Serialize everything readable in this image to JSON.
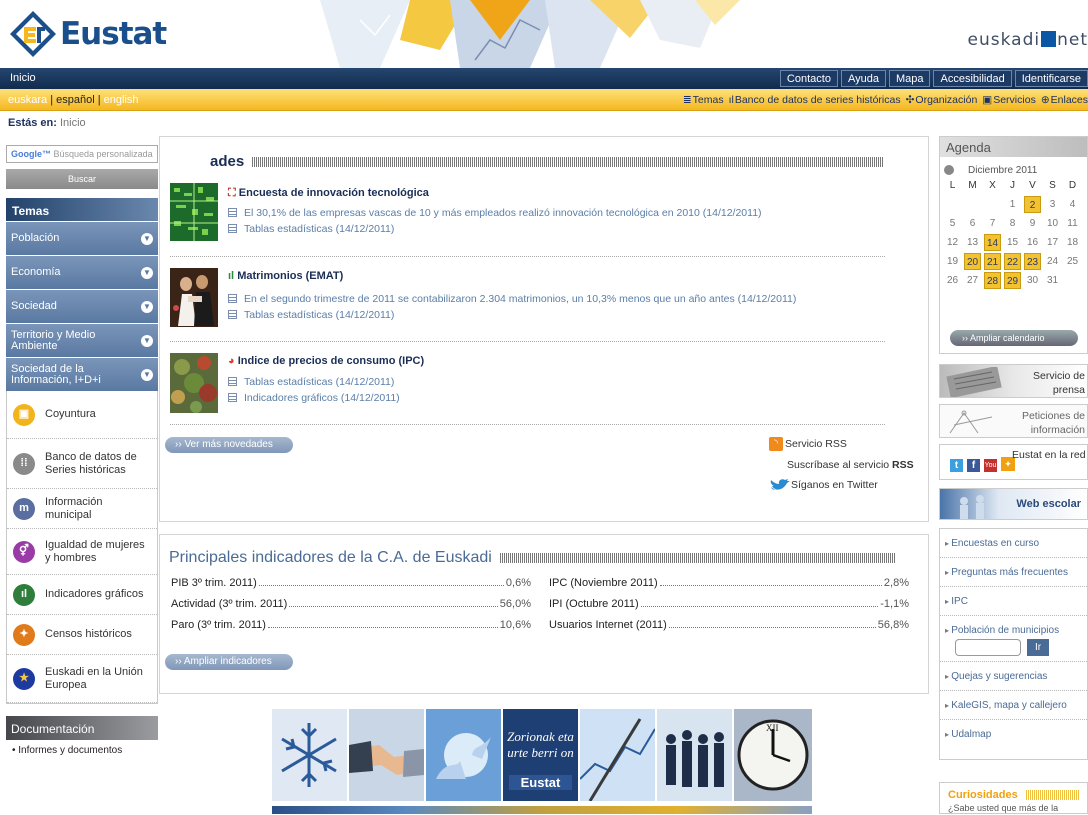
{
  "header": {
    "logo_text": "Eustat",
    "euskadinet": {
      "pre": "euskadi",
      "post": "net"
    }
  },
  "navbar": {
    "home": "Inicio",
    "links": [
      "Contacto",
      "Ayuda",
      "Mapa",
      "Accesibilidad",
      "Identificarse"
    ]
  },
  "langbar": {
    "lang_euskara": "euskara",
    "lang_sep1": " | ",
    "lang_espanol": "español",
    "lang_sep2": " | ",
    "lang_english": "english",
    "sections": [
      "Temas",
      "Banco de datos de series históricas",
      "Organización",
      "Servicios",
      "Enlaces"
    ]
  },
  "breadcrumb": {
    "label": "Estás en:",
    "current": "Inicio"
  },
  "left": {
    "search_placeholder": "Búsqueda personalizada",
    "google": "Google™",
    "search_button": "Buscar",
    "temas_title": "Temas",
    "temas": [
      "Población",
      "Economía",
      "Sociedad",
      "Territorio y Medio Ambiente",
      "Sociedad de la Información, I+D+i"
    ],
    "tools": [
      "Coyuntura",
      "Banco de datos de Series históricas",
      "Información municipal",
      "Igualdad de mujeres y hombres",
      "Indicadores gráficos",
      "Censos históricos",
      "Euskadi en la Unión Europea"
    ],
    "docs_title": "Documentación",
    "docs_items": [
      "Informes y documentos"
    ]
  },
  "novedades": {
    "title": "ades",
    "items": [
      {
        "title": "Encuesta de innovación tecnológica",
        "links": [
          "El 30,1% de las empresas vascas de 10 y más empleados realizó innovación tecnológica en 2010 (14/12/2011)",
          "Tablas estadísticas (14/12/2011)"
        ]
      },
      {
        "title": "Matrimonios (EMAT)",
        "links": [
          "En el segundo trimestre de 2011 se contabilizaron 2.304 matrimonios, un 10,3% menos que un año antes (14/12/2011)",
          "Tablas estadísticas (14/12/2011)"
        ]
      },
      {
        "title": "Indice de precios de consumo (IPC)",
        "links": [
          "Tablas estadísticas (14/12/2011)",
          "Indicadores gráficos (14/12/2011)"
        ]
      }
    ],
    "more_button": "›› Ver más novedades",
    "rss": "Servicio RSS",
    "rss_sub": "Suscríbase al servicio",
    "rss_bold": "RSS",
    "twitter": "Síganos en Twitter"
  },
  "indicators": {
    "title": "Principales indicadores de la C.A. de Euskadi",
    "left": [
      {
        "k": "PIB 3º trim. 2011)",
        "v": "0,6%"
      },
      {
        "k": "Actividad (3º trim. 2011)",
        "v": "56,0%"
      },
      {
        "k": "Paro (3º trim. 2011)",
        "v": "10,6%"
      }
    ],
    "right": [
      {
        "k": "IPC (Noviembre 2011)",
        "v": "2,8%"
      },
      {
        "k": "IPI (Octubre 2011)",
        "v": "-1,1%"
      },
      {
        "k": "Usuarios Internet (2011)",
        "v": "56,8%"
      }
    ],
    "more_button": "›› Ampliar indicadores"
  },
  "greeting": {
    "line1": "Zorionak eta",
    "line2": "urte berri on",
    "brand": "Eustat"
  },
  "agenda": {
    "title": "Agenda",
    "month": "Diciembre 2011",
    "weekdays": [
      "L",
      "M",
      "X",
      "J",
      "V",
      "S",
      "D"
    ],
    "days": [
      "",
      "",
      "",
      "1",
      "2",
      "3",
      "4",
      "5",
      "6",
      "7",
      "8",
      "9",
      "10",
      "11",
      "12",
      "13",
      "14",
      "15",
      "16",
      "17",
      "18",
      "19",
      "20",
      "21",
      "22",
      "23",
      "24",
      "25",
      "26",
      "27",
      "28",
      "29",
      "30",
      "31"
    ],
    "event_days": [
      "2",
      "14",
      "20",
      "21",
      "22",
      "23",
      "28",
      "29"
    ],
    "more_button": "›› Ampliar calendario"
  },
  "right": {
    "prensa": [
      "Servicio de",
      "prensa"
    ],
    "peticiones": [
      "Peticiones de",
      "información"
    ],
    "social": "Eustat en la red",
    "escolar": "Web escolar",
    "links": [
      "Encuestas en curso",
      "Preguntas más frecuentes",
      "IPC",
      "Población de municipios",
      "Quejas y sugerencias",
      "KaleGIS, mapa y callejero",
      "Udalmap"
    ],
    "go_button": "Ir",
    "curiosidades_title": "Curiosidades",
    "curiosidades_text": "¿Sabe usted que más de la"
  }
}
